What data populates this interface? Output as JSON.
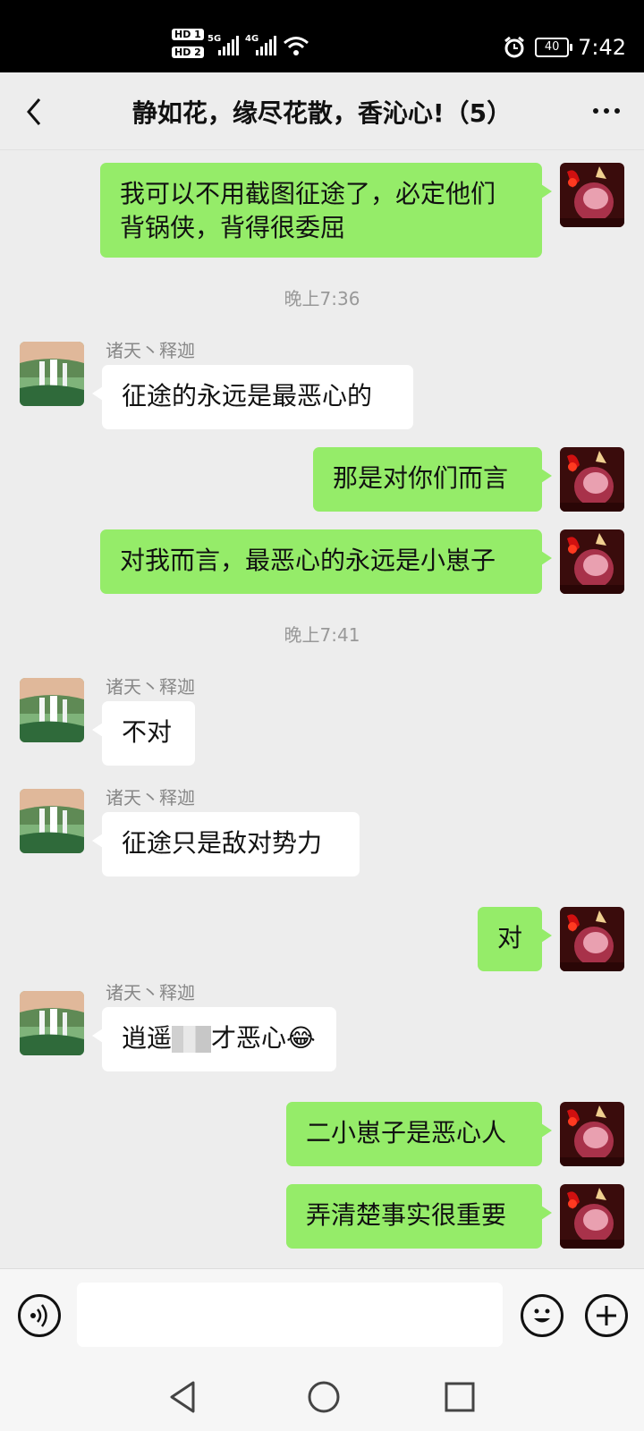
{
  "status_bar": {
    "time": "7:42",
    "battery": "40",
    "net1": "5G",
    "net2": "4G",
    "sim1": "HD 1",
    "sim2": "HD 2"
  },
  "header": {
    "title": "静如花，缘尽花散，香沁心!（5）"
  },
  "messages": {
    "m1": {
      "text_line1": "我可以不用截图征途了，必定他们",
      "text_line2": "背锅侠，背得很委屈"
    },
    "t1": "晚上7:36",
    "m2": {
      "sender": "诸天丶释迦",
      "text": "征途的永远是最恶心的"
    },
    "m3": {
      "text": "那是对你们而言"
    },
    "m4": {
      "text": "对我而言，最恶心的永远是小崽子"
    },
    "t2": "晚上7:41",
    "m5": {
      "sender": "诸天丶释迦",
      "text": "不对"
    },
    "m6": {
      "sender": "诸天丶释迦",
      "text": "征途只是敌对势力"
    },
    "m7": {
      "text": "对"
    },
    "m8": {
      "sender": "诸天丶释迦",
      "text_pre": "逍遥",
      "text_post": "才恶心",
      "emoji": "😂"
    },
    "m9": {
      "text": "二小崽子是恶心人"
    },
    "m10": {
      "text": "弄清楚事实很重要"
    }
  },
  "input_bar": {
    "placeholder": ""
  },
  "icons": {
    "back": "chevron-left-icon",
    "more": "more-icon",
    "voice": "voice-icon",
    "emoji": "emoji-icon",
    "plus": "plus-icon",
    "nav_back": "nav-back-icon",
    "nav_home": "nav-home-icon",
    "nav_recent": "nav-recent-icon"
  },
  "colors": {
    "my_bubble": "#95ec69",
    "other_bubble": "#ffffff",
    "background": "#ededed",
    "status_bar": "#000000"
  }
}
